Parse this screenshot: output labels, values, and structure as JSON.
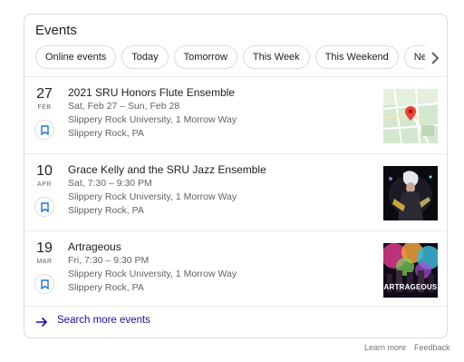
{
  "panel": {
    "title": "Events"
  },
  "chips": [
    "Online events",
    "Today",
    "Tomorrow",
    "This Week",
    "This Weekend",
    "Next Week"
  ],
  "events": [
    {
      "day": "27",
      "month": "FEB",
      "title": "2021 SRU Honors Flute Ensemble",
      "date": "Sat, Feb 27 – Sun, Feb 28",
      "venue": "Slippery Rock University, 1 Morrow Way",
      "city": "Slippery Rock, PA"
    },
    {
      "day": "10",
      "month": "APR",
      "title": "Grace Kelly and the SRU Jazz Ensemble",
      "date": "Sat, 7:30 – 9:30 PM",
      "venue": "Slippery Rock University, 1 Morrow Way",
      "city": "Slippery Rock, PA"
    },
    {
      "day": "19",
      "month": "MAR",
      "title": "Artrageous",
      "date": "Fri, 7:30 – 9:30 PM",
      "venue": "Slippery Rock University, 1 Morrow Way",
      "city": "Slippery Rock, PA",
      "poster_text": "ARTRAGEOUS"
    }
  ],
  "search_more": "Search more events",
  "footer": {
    "learn_more": "Learn more",
    "feedback": "Feedback"
  },
  "colors": {
    "link": "#1a0dab",
    "bookmark": "#1a73e8",
    "map_pin": "#ea4335"
  }
}
